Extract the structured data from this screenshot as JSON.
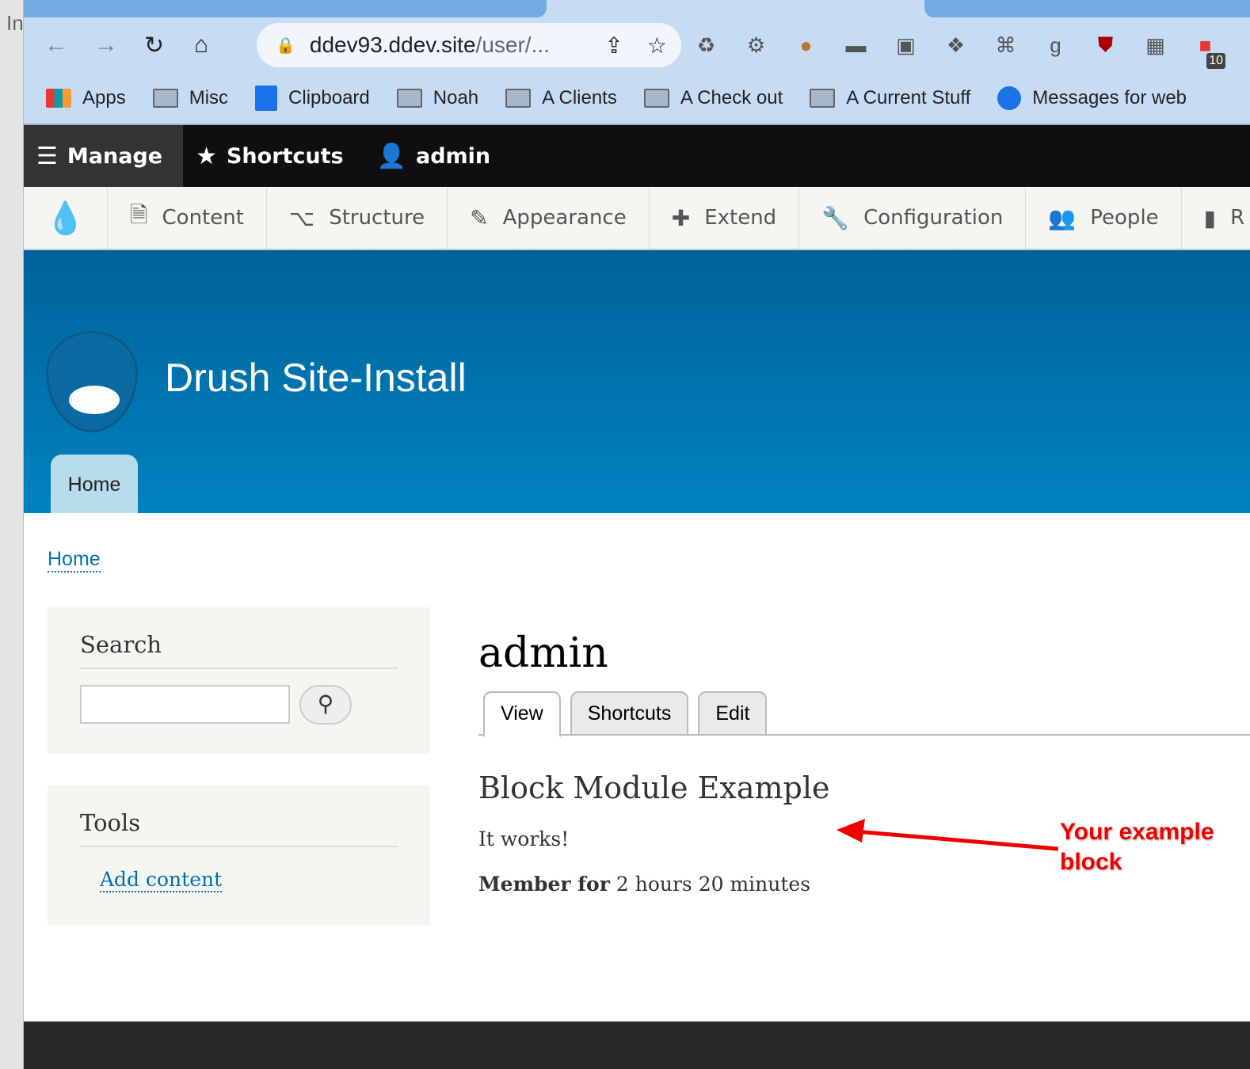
{
  "browser": {
    "url_host": "ddev93.ddev.site",
    "url_path": "/user/...",
    "extension_badge": "10",
    "bookmarks": [
      "Apps",
      "Misc",
      "Clipboard",
      "Noah",
      "A Clients",
      "A Check out",
      "A Current Stuff",
      "Messages for web"
    ]
  },
  "toolbar": {
    "manage": "Manage",
    "shortcuts": "Shortcuts",
    "user": "admin"
  },
  "tray": {
    "items": [
      "Content",
      "Structure",
      "Appearance",
      "Extend",
      "Configuration",
      "People",
      "R"
    ]
  },
  "site": {
    "name": "Drush Site-Install",
    "home_tab": "Home"
  },
  "breadcrumb": "Home",
  "sidebar": {
    "search_title": "Search",
    "search_value": "",
    "tools_title": "Tools",
    "add_content": "Add content"
  },
  "main": {
    "title": "admin",
    "tabs": [
      "View",
      "Shortcuts",
      "Edit"
    ],
    "block_title": "Block Module Example",
    "block_text": "It works!",
    "member_label": "Member for",
    "member_value": "2 hours 20 minutes"
  },
  "annotation": {
    "line1": "Your example",
    "line2": "block",
    "color": "#e00000"
  }
}
